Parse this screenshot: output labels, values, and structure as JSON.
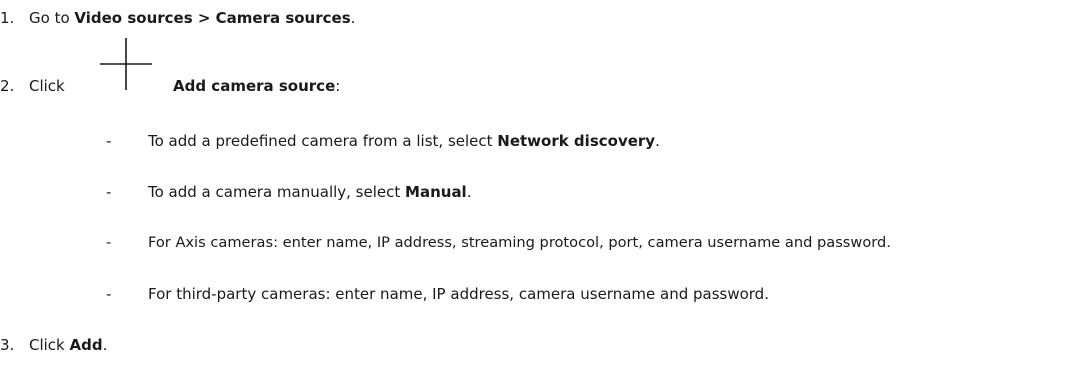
{
  "steps": [
    {
      "number": "1.",
      "text_before": "Go to ",
      "bold": "Video sources > Camera sources",
      "text_after": "."
    },
    {
      "number": "2.",
      "text_before": "Click",
      "icon": "plus-icon",
      "bold": "Add camera source",
      "text_after": ":",
      "sub_items": [
        {
          "bullet": "-",
          "text_before": "To add a predefined camera from a list, select ",
          "bold": "Network discovery",
          "text_after": "."
        },
        {
          "bullet": "-",
          "text_before": "To add a camera manually, select ",
          "bold": "Manual",
          "text_after": "."
        },
        {
          "bullet": "-",
          "text_before": "For Axis cameras: enter name, IP address, streaming protocol, port, camera username and password.",
          "bold": "",
          "text_after": ""
        },
        {
          "bullet": "-",
          "text_before": "For third-party cameras: enter name, IP address, camera username and password.",
          "bold": "",
          "text_after": ""
        }
      ]
    },
    {
      "number": "3.",
      "text_before": "Click ",
      "bold": "Add",
      "text_after": "."
    }
  ]
}
